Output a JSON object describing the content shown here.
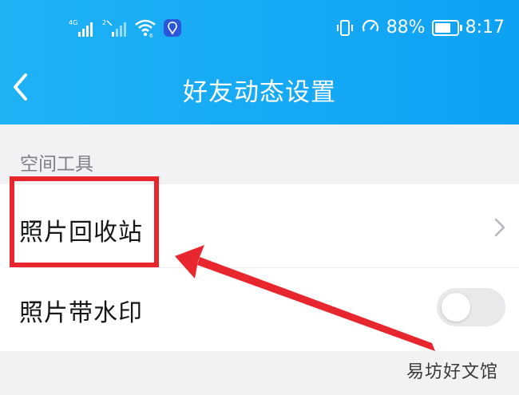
{
  "status_bar": {
    "battery_percent": "88%",
    "battery_level": 0.88,
    "time": "8:17",
    "icons": [
      "signal-4g-icon",
      "signal-2-icon",
      "wifi-icon",
      "vpn-shield-icon",
      "vibrate-icon",
      "data-saver-icon",
      "battery-icon"
    ]
  },
  "nav": {
    "back_icon": "chevron-left-icon",
    "title": "好友动态设置"
  },
  "section": {
    "label": "空间工具"
  },
  "settings": [
    {
      "label": "照片回收站",
      "control": "chevron-right-icon"
    },
    {
      "label": "照片带水印",
      "control": "toggle",
      "enabled": false
    }
  ],
  "annotation": {
    "color": "#e8262d"
  },
  "watermark": {
    "text": "易坊好文馆"
  },
  "colors": {
    "header": "#16a9f5",
    "background": "#f2f2f4",
    "highlight": "#e8262d"
  }
}
